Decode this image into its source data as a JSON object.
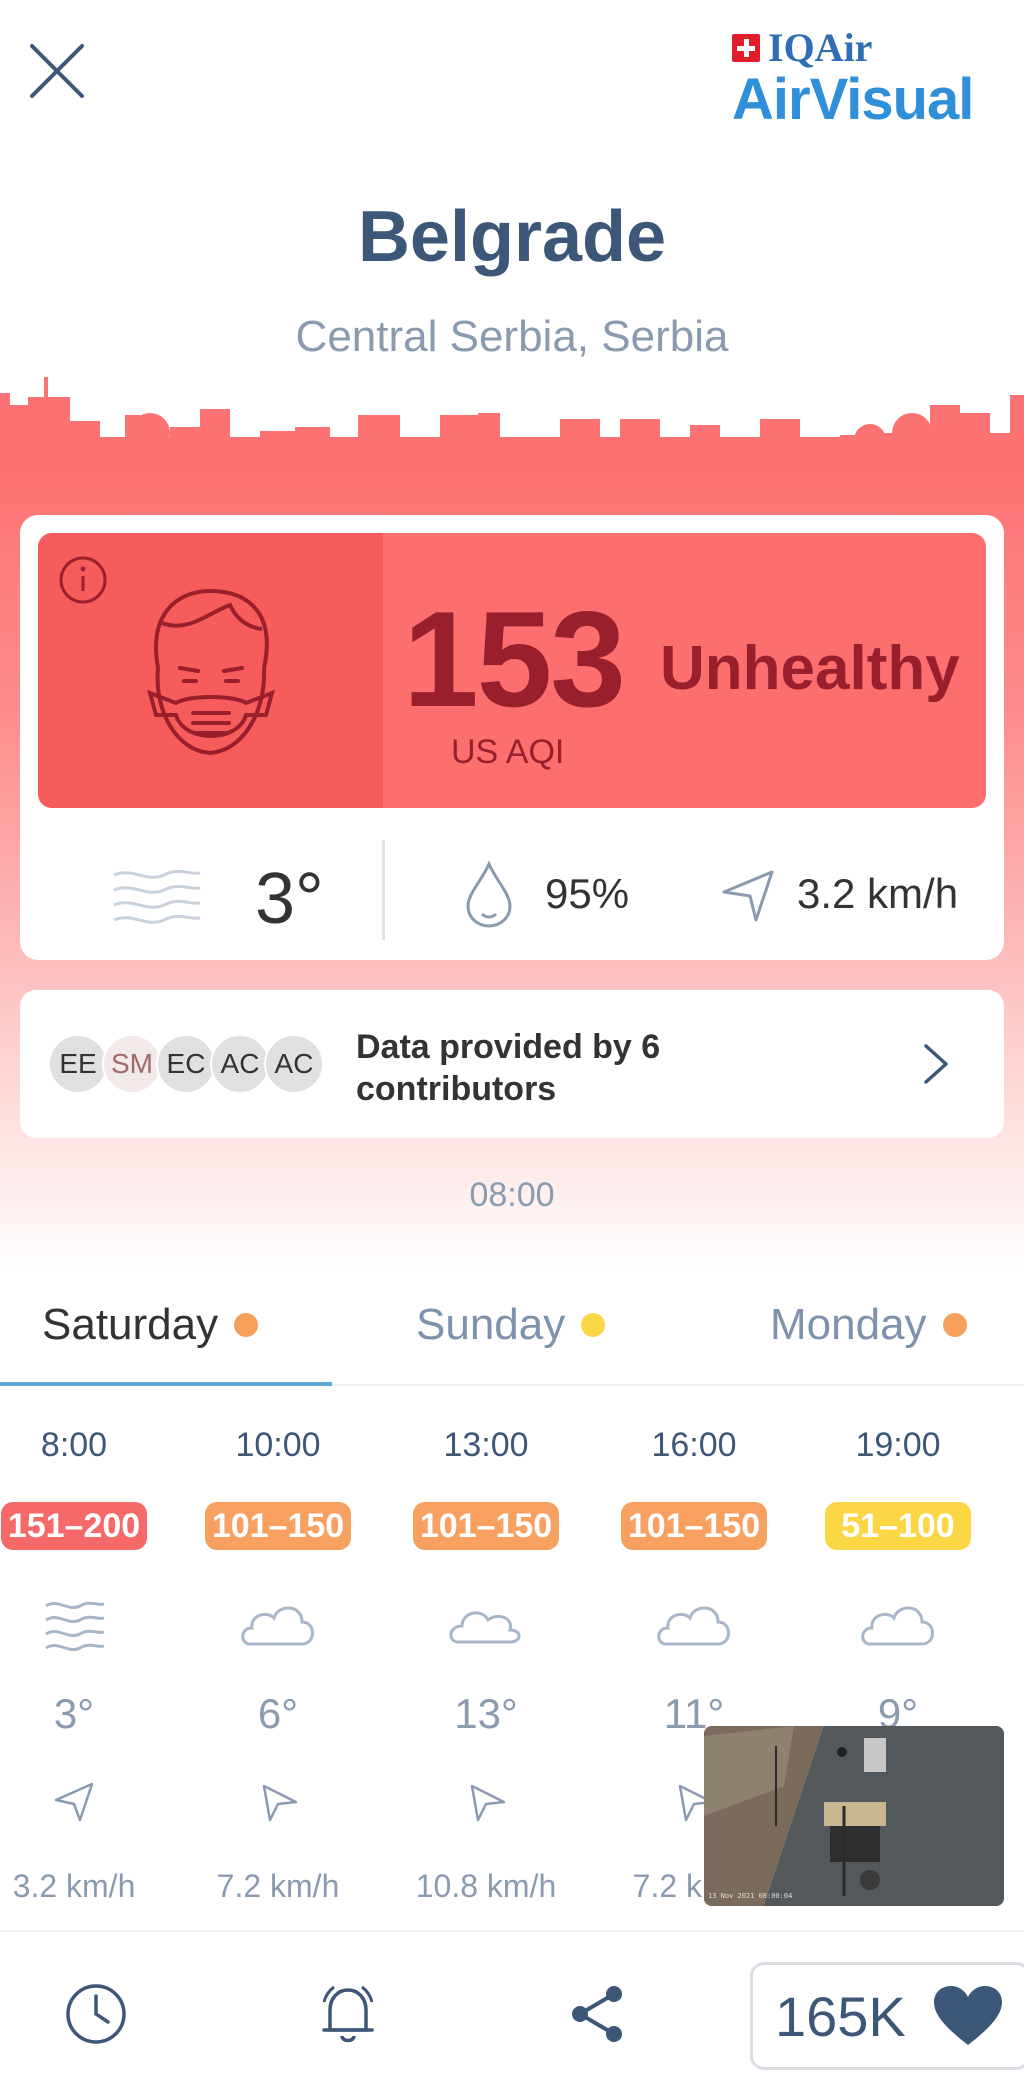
{
  "header": {
    "logo_top": "IQAir",
    "logo_brand": "AirVisual"
  },
  "location": {
    "city": "Belgrade",
    "region": "Central Serbia, Serbia"
  },
  "aqi": {
    "value": "153",
    "unit": "US AQI",
    "level": "Unhealthy",
    "color": "#fd6e6e"
  },
  "weather": {
    "temperature": "3°",
    "humidity": "95%",
    "wind": "3.2 km/h"
  },
  "contributors": {
    "avatars": [
      "EE",
      "SM",
      "EC",
      "AC",
      "AC"
    ],
    "text": "Data provided by 6 contributors"
  },
  "timestamp": "08:00",
  "tabs": [
    {
      "label": "Saturday",
      "dot_color": "#f7a05b",
      "active": true
    },
    {
      "label": "Sunday",
      "dot_color": "#fbd746",
      "active": false
    },
    {
      "label": "Monday",
      "dot_color": "#f7a05b",
      "active": false
    }
  ],
  "forecast": [
    {
      "time": "8:00",
      "aqi_range": "151–200",
      "aqi_color": "#f56969",
      "weather_icon": "wind-icon",
      "temp": "3°",
      "wind_direction_icon": "wind-direction-icon",
      "wind": "3.2 km/h"
    },
    {
      "time": "10:00",
      "aqi_range": "101–150",
      "aqi_color": "#f8a060",
      "weather_icon": "cloud-icon",
      "temp": "6°",
      "wind_direction_icon": "wind-direction-icon",
      "wind": "7.2 km/h"
    },
    {
      "time": "13:00",
      "aqi_range": "101–150",
      "aqi_color": "#f8a060",
      "weather_icon": "cloud-icon",
      "temp": "13°",
      "wind_direction_icon": "wind-direction-icon",
      "wind": "10.8 km/h"
    },
    {
      "time": "16:00",
      "aqi_range": "101–150",
      "aqi_color": "#f8a060",
      "weather_icon": "cloud-icon",
      "temp": "11°",
      "wind_direction_icon": "wind-direction-icon",
      "wind": "7.2 km/h"
    },
    {
      "time": "19:00",
      "aqi_range": "51–100",
      "aqi_color": "#fbd746",
      "weather_icon": "cloud-icon",
      "temp": "9°",
      "wind_direction_icon": "wind-direction-icon",
      "wind": ""
    }
  ],
  "camera": {
    "overlay_text": "13 Nov 2021 08:00:04"
  },
  "bottom_bar": {
    "like_count": "165K"
  }
}
